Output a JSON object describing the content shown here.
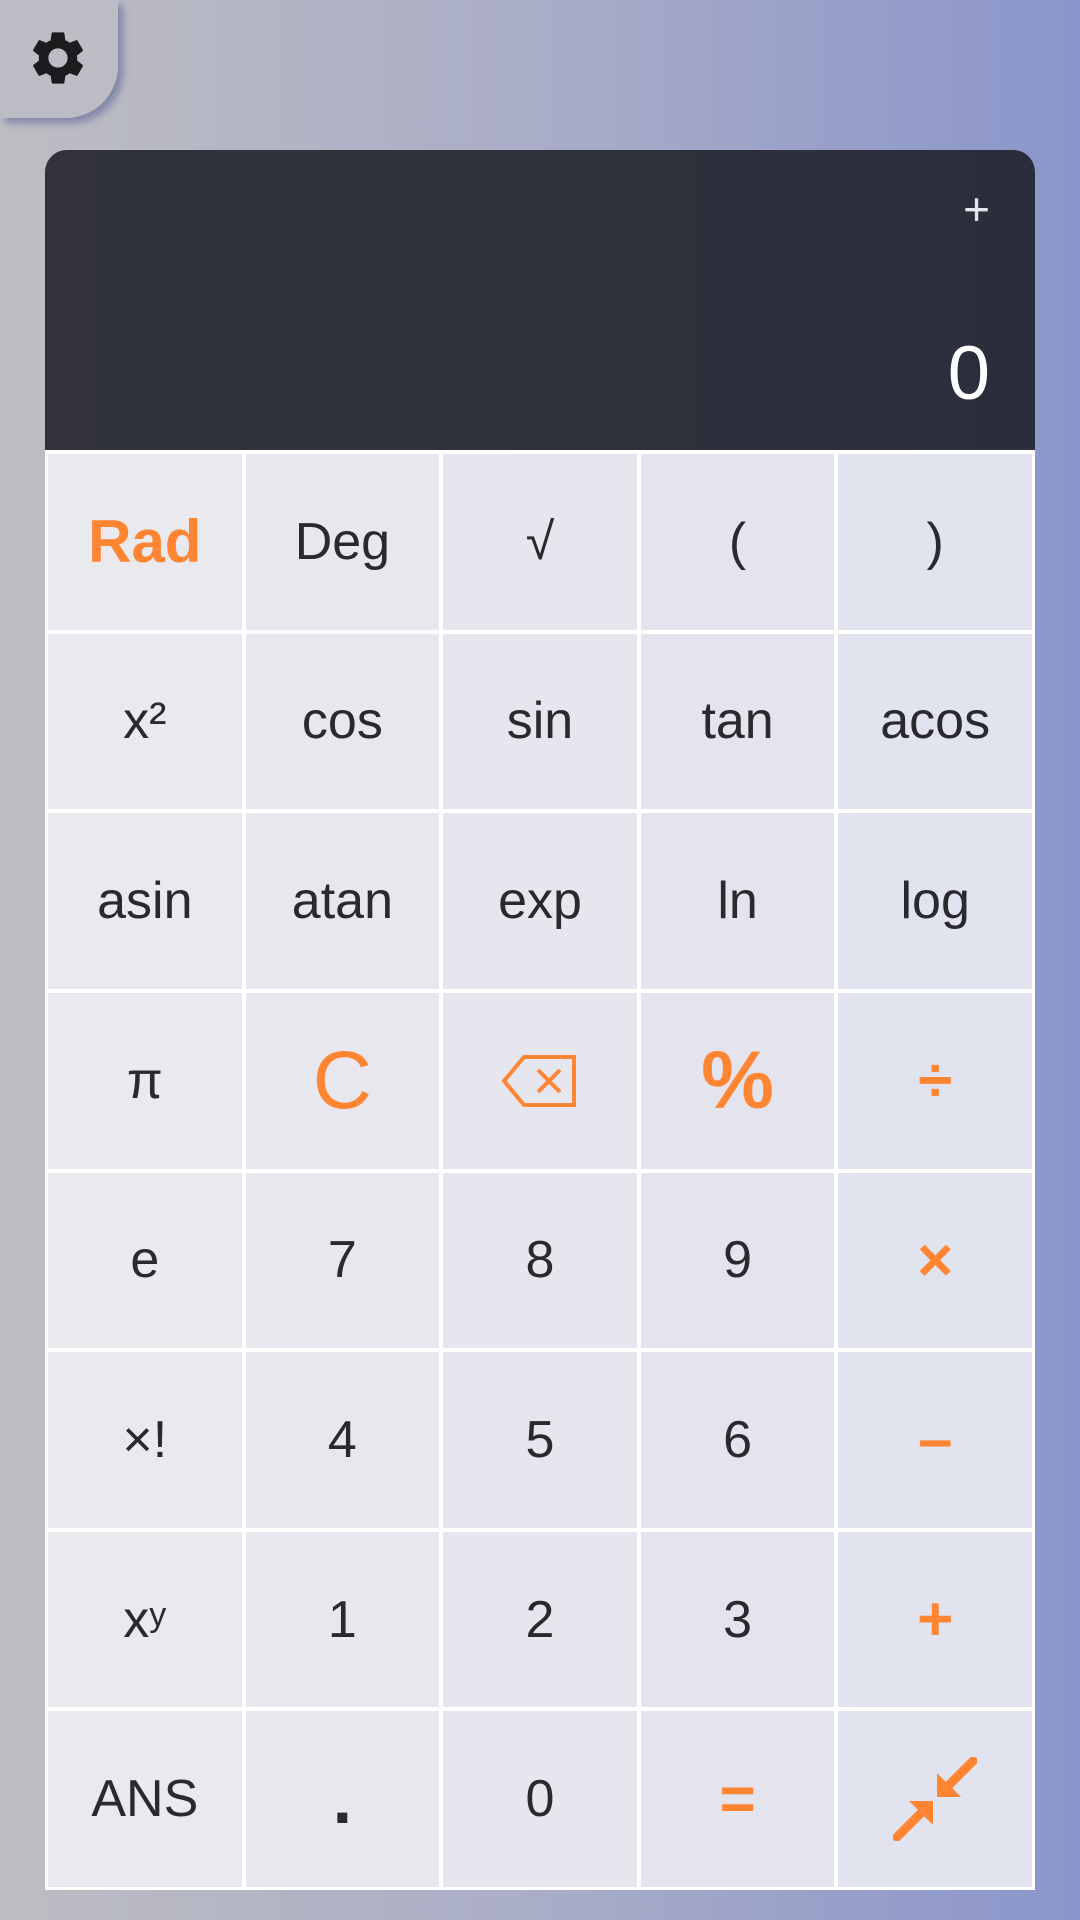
{
  "settings": {
    "icon": "gear-icon"
  },
  "display": {
    "history_toggle": "+",
    "result": "0"
  },
  "colors": {
    "accent": "#ff8533",
    "display_bg": "#2e313c",
    "key_bg": "#e5e6ee"
  },
  "keys": {
    "rad": "Rad",
    "deg": "Deg",
    "sqrt": "√",
    "lparen": "(",
    "rparen": ")",
    "square": "x²",
    "cos": "cos",
    "sin": "sin",
    "tan": "tan",
    "acos": "acos",
    "asin": "asin",
    "atan": "atan",
    "exp": "exp",
    "ln": "ln",
    "log": "log",
    "pi": "π",
    "clear": "C",
    "backspace_icon": "backspace-icon",
    "percent": "%",
    "divide": "÷",
    "e": "e",
    "seven": "7",
    "eight": "8",
    "nine": "9",
    "multiply": "×",
    "factorial": "×!",
    "four": "4",
    "five": "5",
    "six": "6",
    "minus": "–",
    "power_base": "x",
    "power_exp": "y",
    "one": "1",
    "two": "2",
    "three": "3",
    "plus": "+",
    "ans": "ANS",
    "decimal": ".",
    "zero": "0",
    "equals": "=",
    "collapse_icon": "collapse-arrows-icon"
  }
}
